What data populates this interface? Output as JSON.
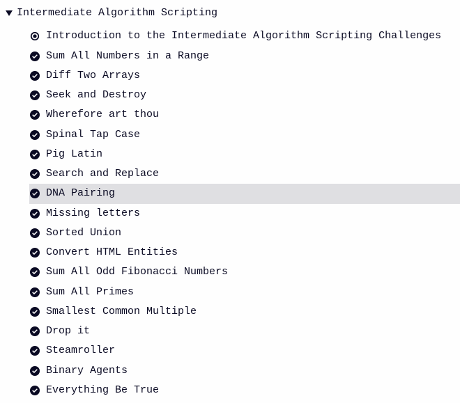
{
  "section": {
    "title": "Intermediate Algorithm Scripting",
    "expanded": true,
    "items": [
      {
        "label": "Introduction to the Intermediate Algorithm Scripting Challenges",
        "status": "current",
        "selected": false
      },
      {
        "label": "Sum All Numbers in a Range",
        "status": "complete",
        "selected": false
      },
      {
        "label": "Diff Two Arrays",
        "status": "complete",
        "selected": false
      },
      {
        "label": "Seek and Destroy",
        "status": "complete",
        "selected": false
      },
      {
        "label": "Wherefore art thou",
        "status": "complete",
        "selected": false
      },
      {
        "label": "Spinal Tap Case",
        "status": "complete",
        "selected": false
      },
      {
        "label": "Pig Latin",
        "status": "complete",
        "selected": false
      },
      {
        "label": "Search and Replace",
        "status": "complete",
        "selected": false
      },
      {
        "label": "DNA Pairing",
        "status": "complete",
        "selected": true
      },
      {
        "label": "Missing letters",
        "status": "complete",
        "selected": false
      },
      {
        "label": "Sorted Union",
        "status": "complete",
        "selected": false
      },
      {
        "label": "Convert HTML Entities",
        "status": "complete",
        "selected": false
      },
      {
        "label": "Sum All Odd Fibonacci Numbers",
        "status": "complete",
        "selected": false
      },
      {
        "label": "Sum All Primes",
        "status": "complete",
        "selected": false
      },
      {
        "label": "Smallest Common Multiple",
        "status": "complete",
        "selected": false
      },
      {
        "label": "Drop it",
        "status": "complete",
        "selected": false
      },
      {
        "label": "Steamroller",
        "status": "complete",
        "selected": false
      },
      {
        "label": "Binary Agents",
        "status": "complete",
        "selected": false
      },
      {
        "label": "Everything Be True",
        "status": "complete",
        "selected": false
      }
    ]
  }
}
